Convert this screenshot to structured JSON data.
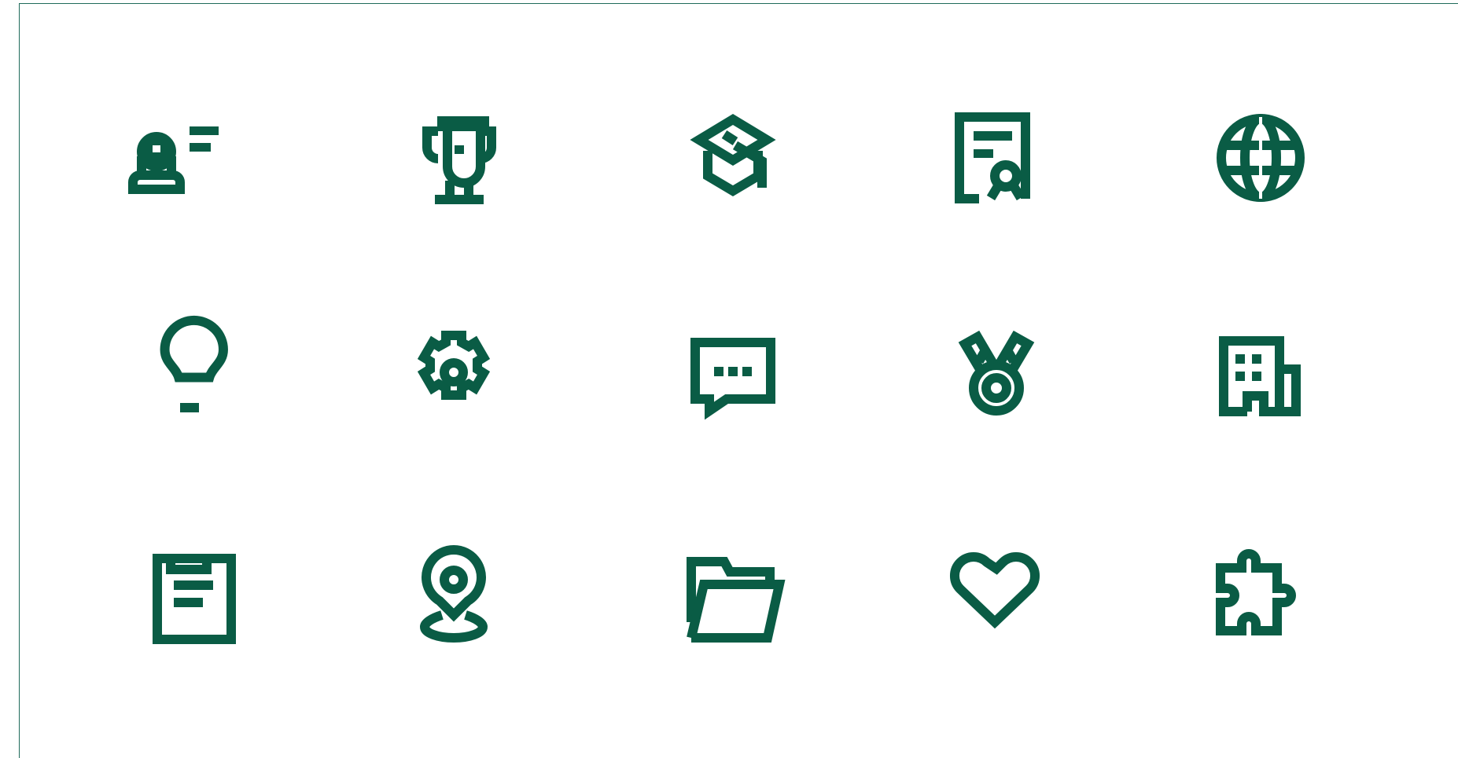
{
  "theme": {
    "ink": "#0a5c45",
    "frame": "#1f6b5a",
    "background": "#ffffff"
  },
  "icons": [
    {
      "name": "presenter-icon"
    },
    {
      "name": "trophy-icon"
    },
    {
      "name": "graduation-cap-icon"
    },
    {
      "name": "certificate-icon"
    },
    {
      "name": "globe-icon"
    },
    {
      "name": "lightbulb-icon"
    },
    {
      "name": "gear-icon"
    },
    {
      "name": "chat-bubble-icon"
    },
    {
      "name": "medal-icon"
    },
    {
      "name": "office-building-icon"
    },
    {
      "name": "document-icon"
    },
    {
      "name": "location-pin-icon"
    },
    {
      "name": "open-folder-icon"
    },
    {
      "name": "heart-icon"
    },
    {
      "name": "puzzle-piece-icon"
    }
  ]
}
